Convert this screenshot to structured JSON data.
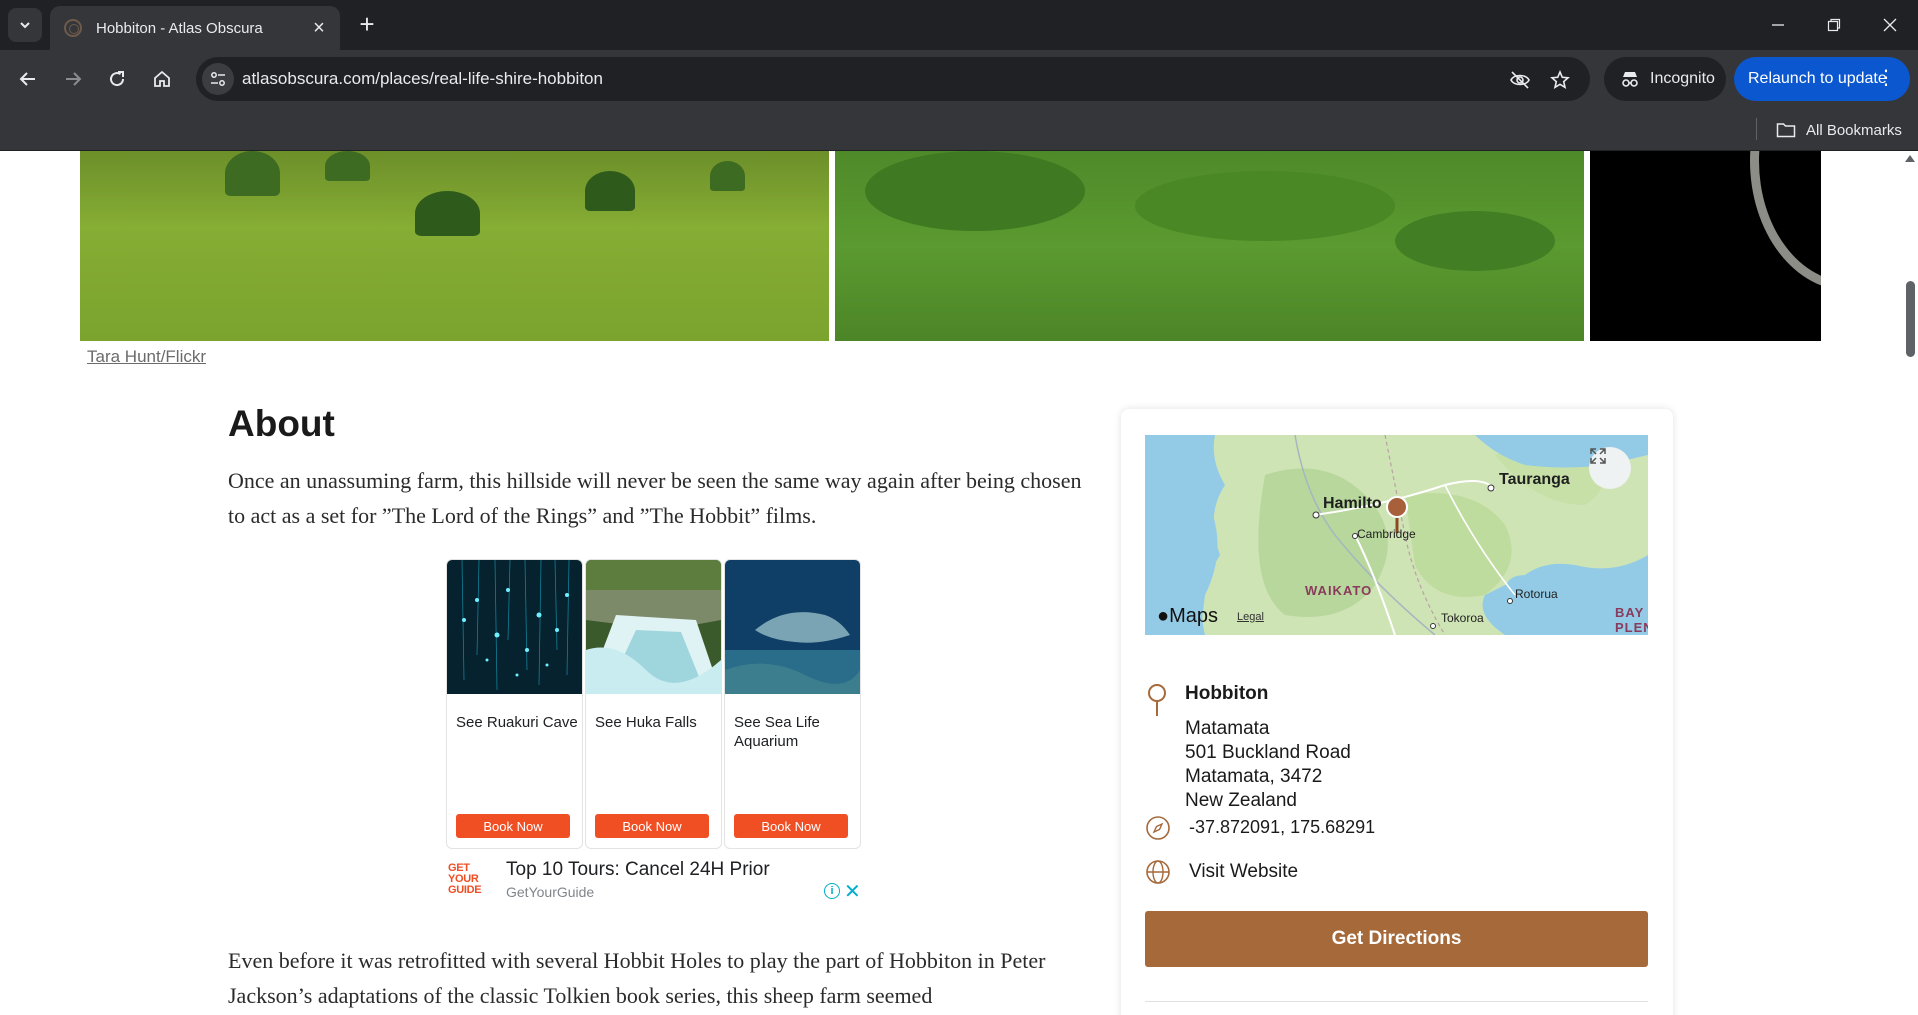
{
  "browser": {
    "tab_title": "Hobbiton - Atlas Obscura",
    "url": "atlasobscura.com/places/real-life-shire-hobbiton",
    "incognito_label": "Incognito",
    "relaunch_label": "Relaunch to update",
    "bookmarks_label": "All Bookmarks"
  },
  "gallery": {
    "credit": "Tara Hunt/Flickr"
  },
  "article": {
    "heading": "About",
    "para1": "Once an unassuming farm, this hillside will never be seen the same way again after being chosen to act as a set for ”The Lord of the Rings” and ”The Hobbit” films.",
    "para2": "Even before it was retrofitted with several Hobbit Holes to play the part of Hobbiton in Peter Jackson’s adaptations of the classic Tolkien book series, this sheep farm seemed"
  },
  "ad": {
    "cards": [
      {
        "caption": "See Ruakuri Cave",
        "button": "Book Now"
      },
      {
        "caption": "See Huka Falls",
        "button": "Book Now"
      },
      {
        "caption": "See Sea Life Aquarium",
        "button": "Book Now"
      }
    ],
    "logo": [
      "GET",
      "YOUR",
      "GUIDE"
    ],
    "title": "Top 10 Tours: Cancel 24H Prior",
    "advertiser": "GetYourGuide"
  },
  "map": {
    "labels": {
      "hamilton": "Hamilto",
      "tauranga": "Tauranga",
      "cambridge": "Cambridge",
      "waikato": "WAIKATO",
      "rotorua": "Rotorua",
      "tokoroa": "Tokoroa",
      "bay": "BAY",
      "plenty": "PLEN"
    },
    "brand": "Maps",
    "legal": "Legal"
  },
  "location": {
    "name": "Hobbiton",
    "address_lines": [
      "Matamata",
      "501 Buckland Road",
      "Matamata, 3472",
      "New Zealand"
    ],
    "coordinates": "-37.872091, 175.68291",
    "website_label": "Visit Website",
    "directions_label": "Get Directions"
  },
  "colors": {
    "accent_brown": "#a5693a",
    "ad_orange": "#f04e23",
    "chrome_dark": "#202124",
    "relaunch_blue": "#0b57d0"
  }
}
